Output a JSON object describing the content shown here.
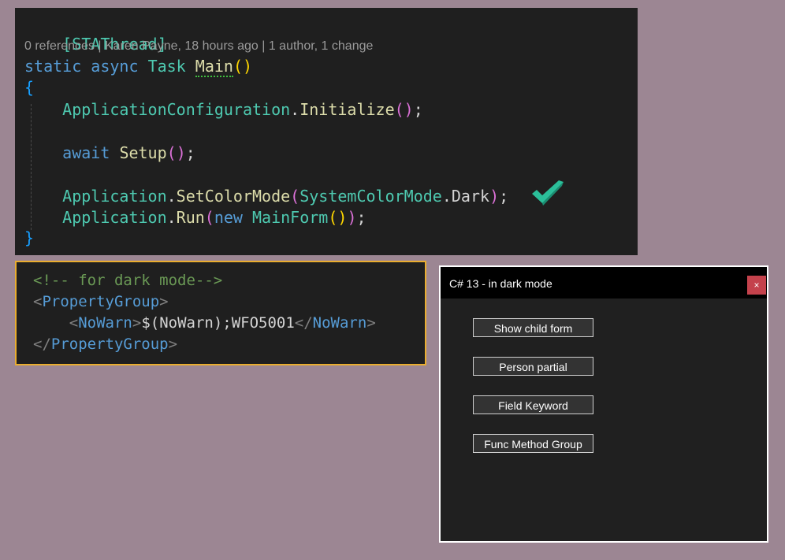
{
  "code": {
    "attribute": "[STAThread]",
    "codelens": "0 references | Karen Payne, 18 hours ago | 1 author, 1 change",
    "kw_static": "static",
    "kw_async": "async",
    "type_task": "Task",
    "fn_main": "Main",
    "open_brace": "{",
    "close_brace": "}",
    "l1_obj": "ApplicationConfiguration",
    "l1_fn": "Initialize",
    "l2_kw": "await",
    "l2_fn": "Setup",
    "l3_obj": "Application",
    "l3_fn": "SetColorMode",
    "l3_enum": "SystemColorMode",
    "l3_member": "Dark",
    "l4_obj": "Application",
    "l4_fn": "Run",
    "l4_kw": "new",
    "l4_type": "MainForm",
    "check_icon": "check-mark-icon",
    "check_color": "#2bbf9a"
  },
  "xml": {
    "comment": "<!-- for dark mode-->",
    "group_tag": "PropertyGroup",
    "nowarn_tag": "NoWarn",
    "nowarn_value": "$(NoWarn);WFO5001"
  },
  "window": {
    "title": "C# 13 - in dark mode",
    "close_label": "×",
    "buttons": [
      {
        "label": "Show child form"
      },
      {
        "label": "Person partial"
      },
      {
        "label": "Field Keyword"
      },
      {
        "label": "Func Method Group"
      }
    ]
  }
}
